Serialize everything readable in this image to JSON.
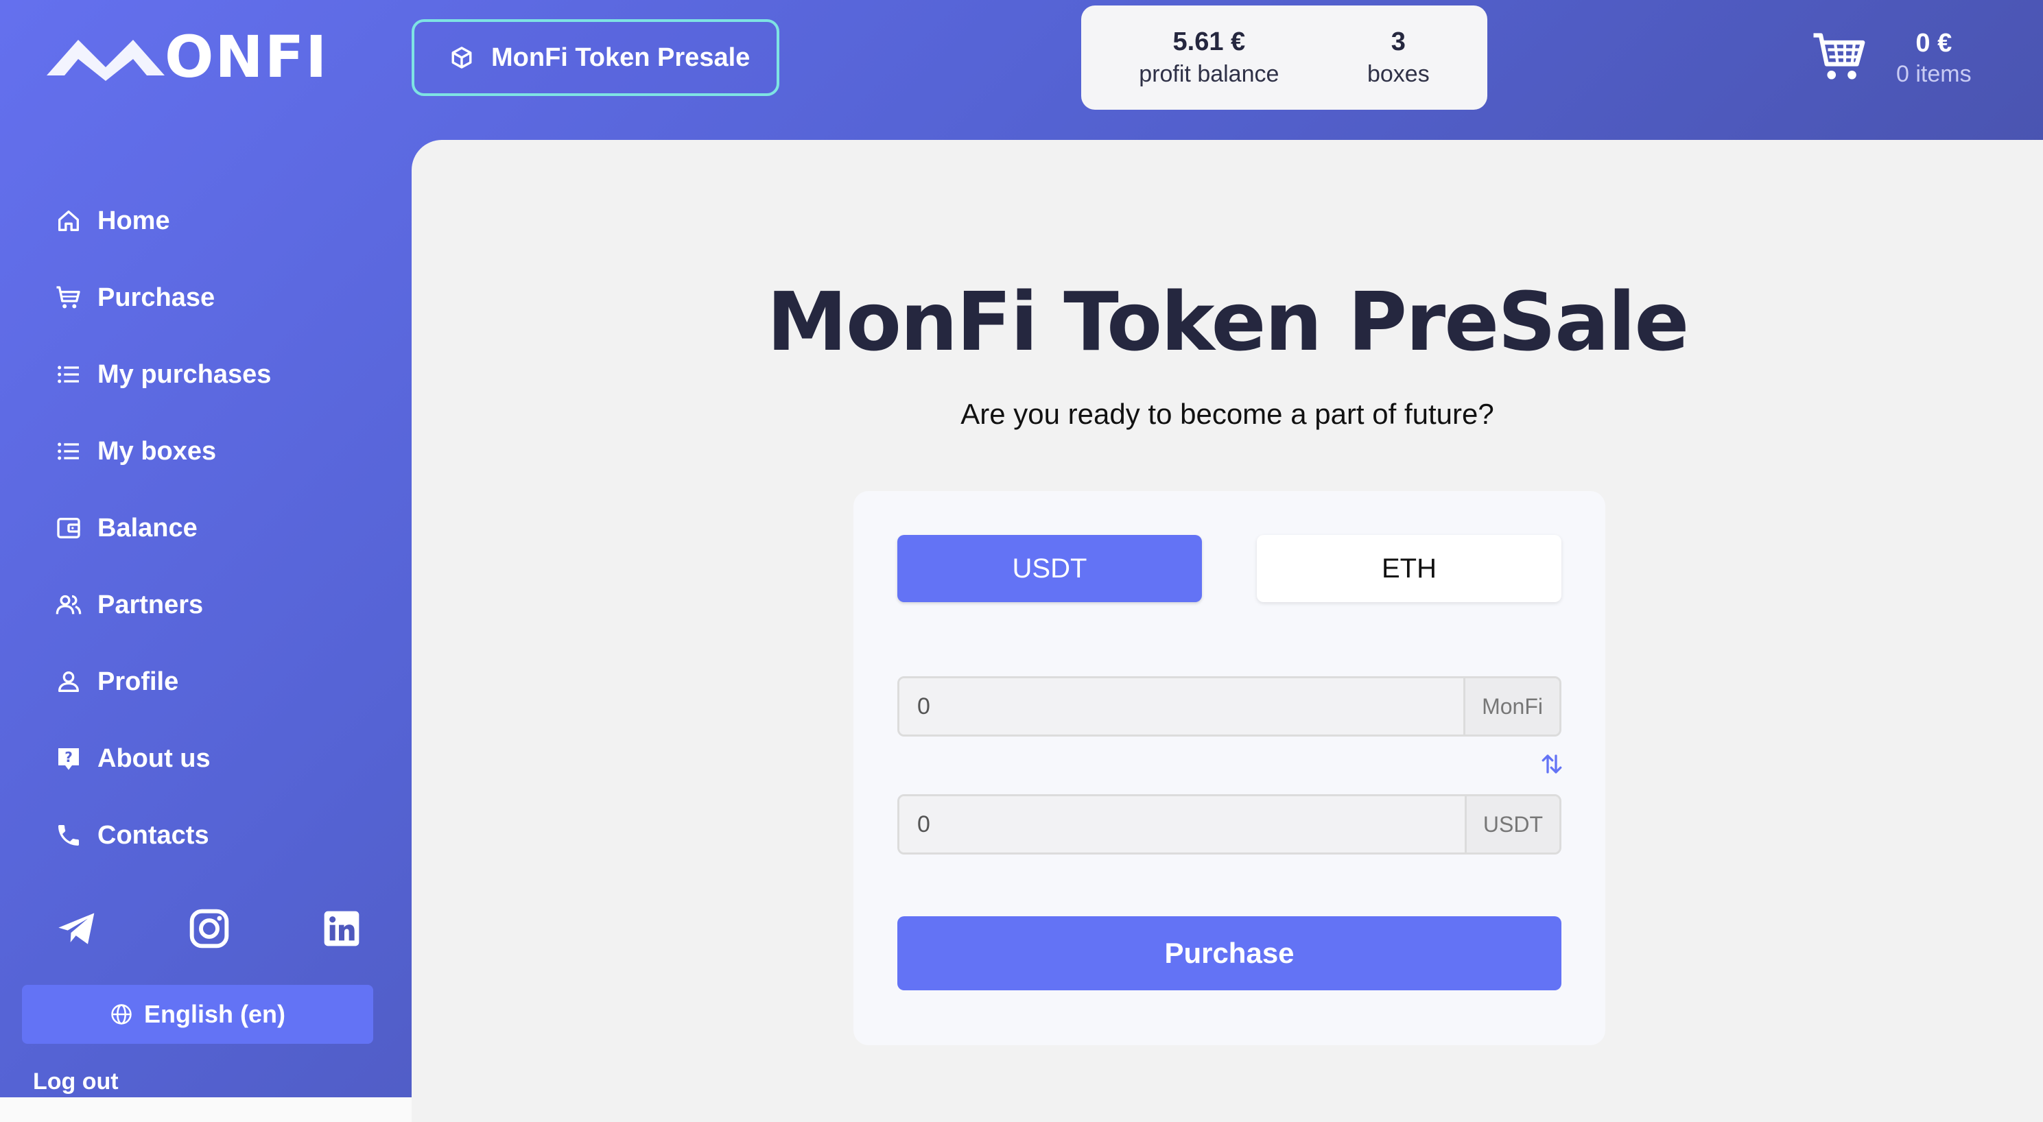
{
  "brand": {
    "logo_text": "ONFI"
  },
  "header": {
    "presale_button_label": "MonFi Token Presale",
    "stats": {
      "profit_value": "5.61 €",
      "profit_label": "profit balance",
      "boxes_value": "3",
      "boxes_label": "boxes"
    },
    "cart": {
      "total": "0 €",
      "items": "0 items"
    }
  },
  "sidebar": {
    "items": [
      {
        "label": "Home",
        "icon": "home-icon"
      },
      {
        "label": "Purchase",
        "icon": "cart-icon"
      },
      {
        "label": "My purchases",
        "icon": "list-icon"
      },
      {
        "label": "My boxes",
        "icon": "list-icon"
      },
      {
        "label": "Balance",
        "icon": "wallet-icon"
      },
      {
        "label": "Partners",
        "icon": "users-icon"
      },
      {
        "label": "Profile",
        "icon": "user-icon"
      },
      {
        "label": "About us",
        "icon": "question-icon"
      },
      {
        "label": "Contacts",
        "icon": "phone-icon"
      }
    ],
    "social": [
      "telegram-icon",
      "instagram-icon",
      "linkedin-icon"
    ],
    "language_label": "English (en)",
    "logout_label": "Log out"
  },
  "main": {
    "title": "MonFi Token PreSale",
    "subtitle": "Are you ready to become a part of future?",
    "currency_tabs": {
      "usdt": "USDT",
      "eth": "ETH"
    },
    "selected_currency": "USDT",
    "token_amount": {
      "value": "0",
      "unit": "MonFi"
    },
    "pay_amount": {
      "value": "0",
      "unit": "USDT"
    },
    "purchase_label": "Purchase"
  },
  "colors": {
    "accent": "#6373f5",
    "sidebar_gradient_start": "#6470ee",
    "sidebar_gradient_end": "#3f479a",
    "title": "#25273f",
    "presale_border": "#7ee3e3"
  }
}
